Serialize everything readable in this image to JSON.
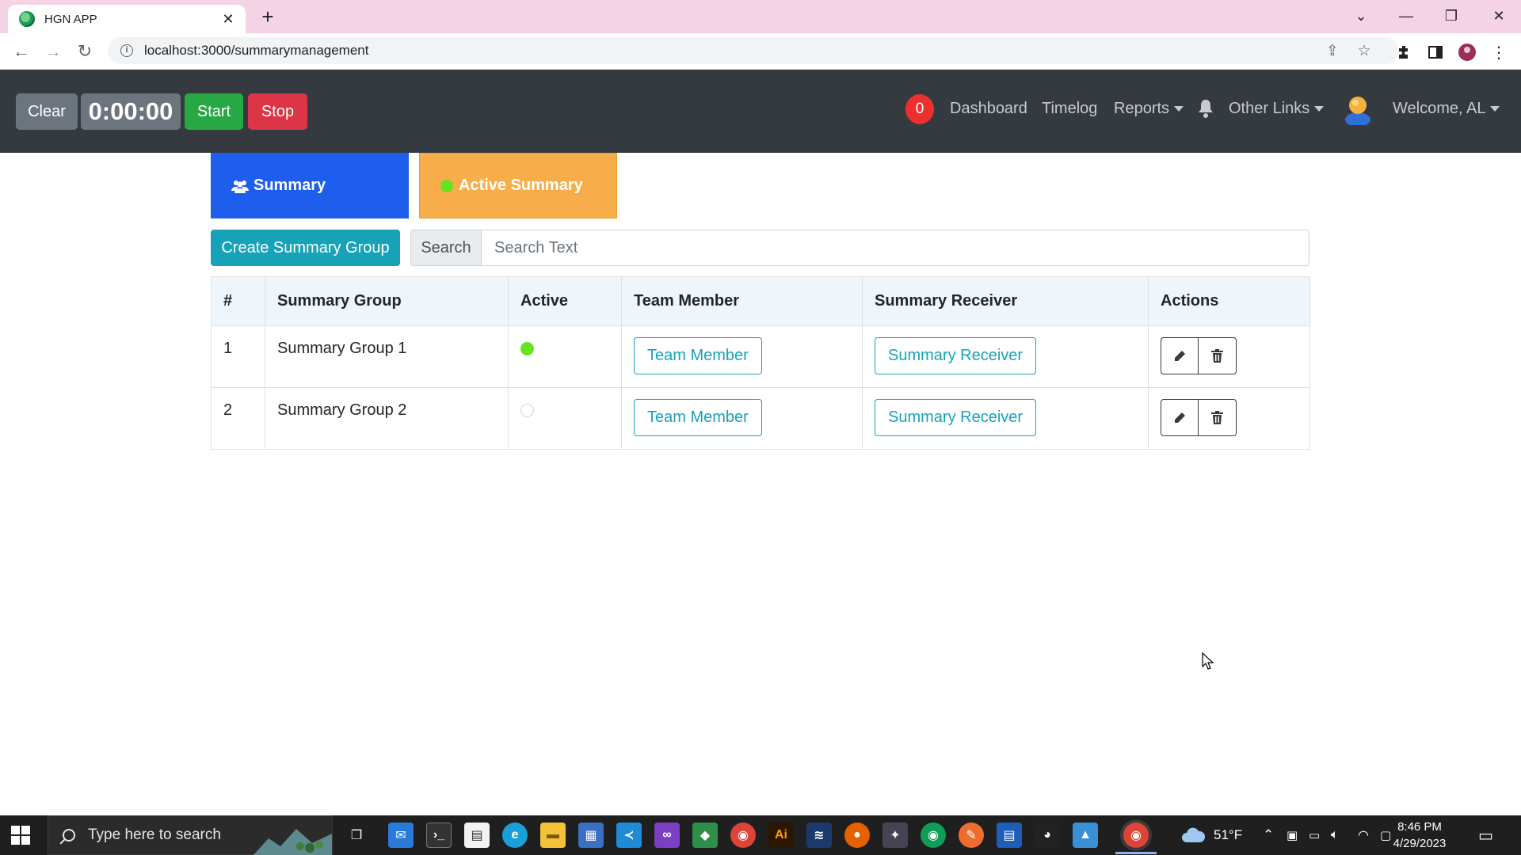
{
  "browser": {
    "tab_title": "HGN APP",
    "url": "localhost:3000/summarymanagement"
  },
  "navbar": {
    "clear_label": "Clear",
    "timer": "0:00:00",
    "start_label": "Start",
    "stop_label": "Stop",
    "badge_count": "0",
    "dashboard": "Dashboard",
    "timelog": "Timelog",
    "reports": "Reports",
    "other_links": "Other Links",
    "welcome": "Welcome, AL"
  },
  "tiles": {
    "summary": "Summary",
    "active_summary": "Active Summary"
  },
  "controls": {
    "create_label": "Create Summary Group",
    "search_label": "Search",
    "search_placeholder": "Search Text"
  },
  "table": {
    "headers": [
      "#",
      "Summary Group",
      "Active",
      "Team Member",
      "Summary Receiver",
      "Actions"
    ],
    "rows": [
      {
        "index": "1",
        "group": "Summary Group 1",
        "active": true,
        "team_member_label": "Team Member",
        "receiver_label": "Summary Receiver"
      },
      {
        "index": "2",
        "group": "Summary Group 2",
        "active": false,
        "team_member_label": "Team Member",
        "receiver_label": "Summary Receiver"
      }
    ]
  },
  "taskbar": {
    "search_placeholder": "Type here to search",
    "weather": "51°F",
    "time": "8:46 PM",
    "date": "4/29/2023"
  },
  "colors": {
    "navbar": "#343a40",
    "summary_tile": "#1e5eec",
    "active_tile": "#f7ad49",
    "info": "#17a2b8",
    "start": "#28a745",
    "stop": "#dc3545",
    "active_dot": "#66e31f"
  }
}
